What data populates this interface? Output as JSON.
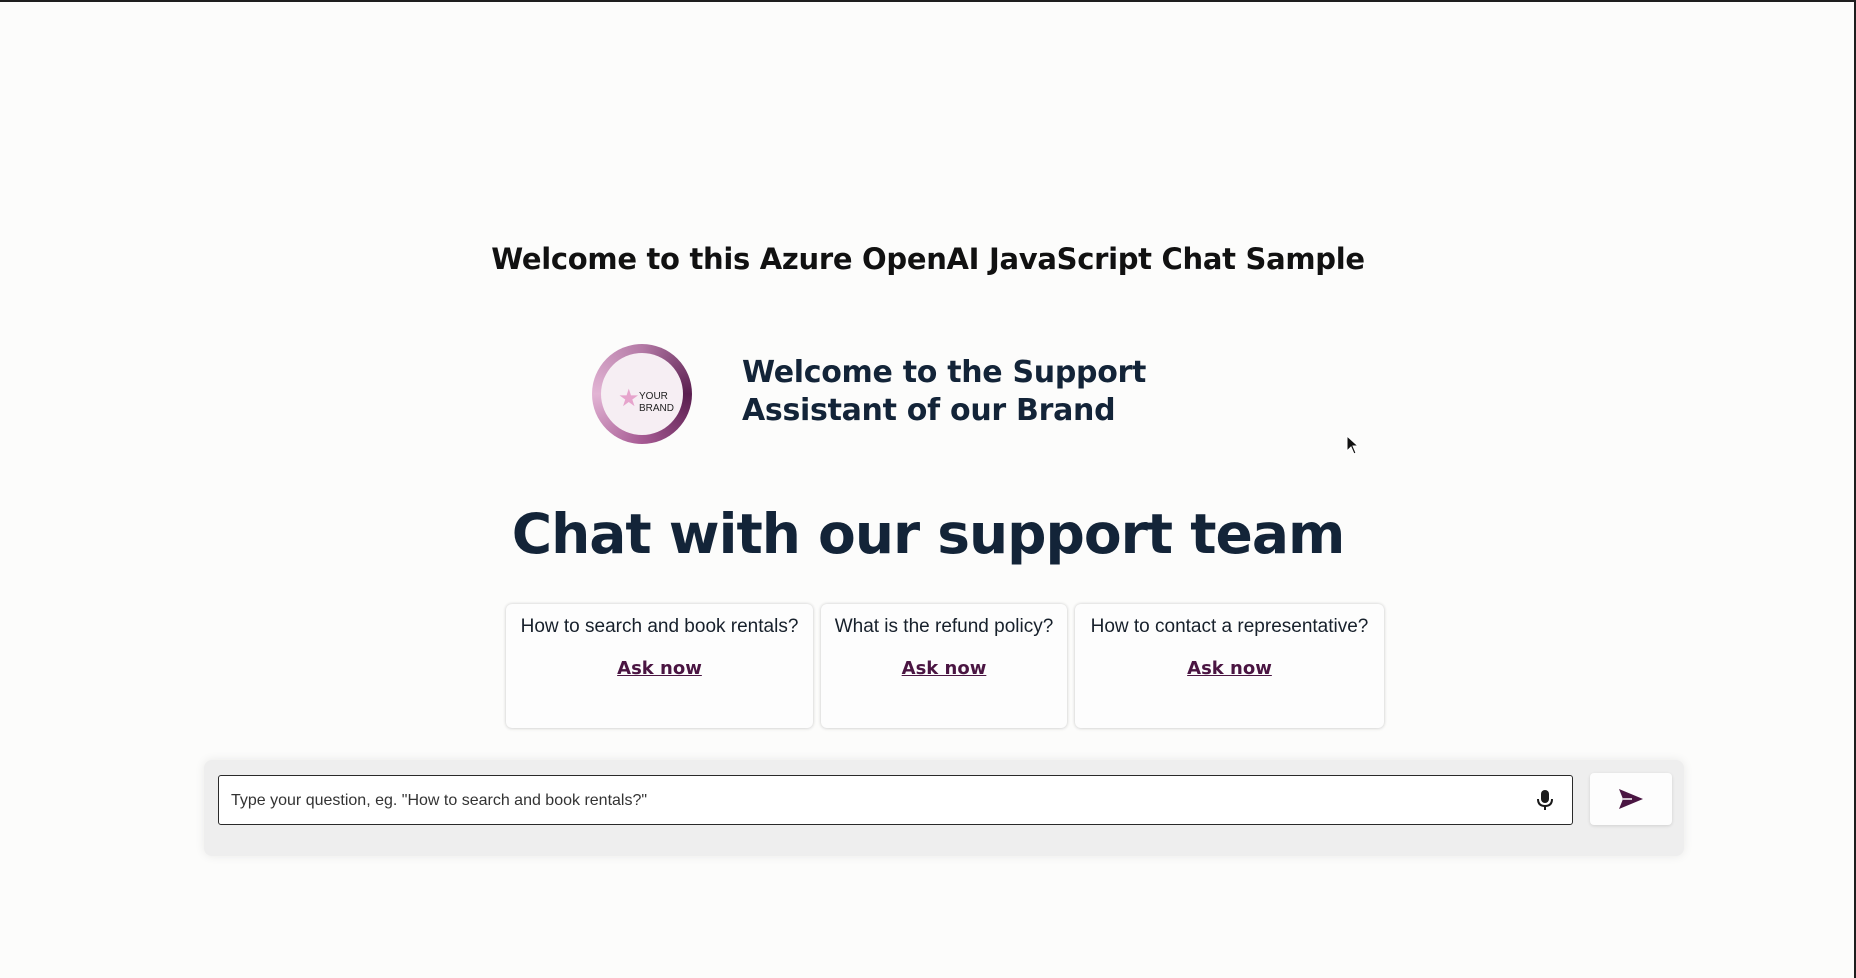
{
  "page": {
    "title": "Welcome to this Azure OpenAI JavaScript Chat Sample"
  },
  "brand": {
    "logo_text": "YOUR\nBRAND",
    "logo_icon": "star-icon",
    "welcome_heading": "Welcome to the Support Assistant of our Brand",
    "accent_color": "#4a1542",
    "heading_color": "#132438"
  },
  "hero": {
    "title": "Chat with our support team"
  },
  "cards": [
    {
      "question": "How to search and book rentals?",
      "ask_label": "Ask now"
    },
    {
      "question": "What is the refund policy?",
      "ask_label": "Ask now"
    },
    {
      "question": "How to contact a representative?",
      "ask_label": "Ask now"
    }
  ],
  "input": {
    "placeholder": "Type your question, eg. \"How to search and book rentals?\"",
    "value": "",
    "mic_icon": "microphone-icon",
    "send_icon": "send-icon"
  }
}
